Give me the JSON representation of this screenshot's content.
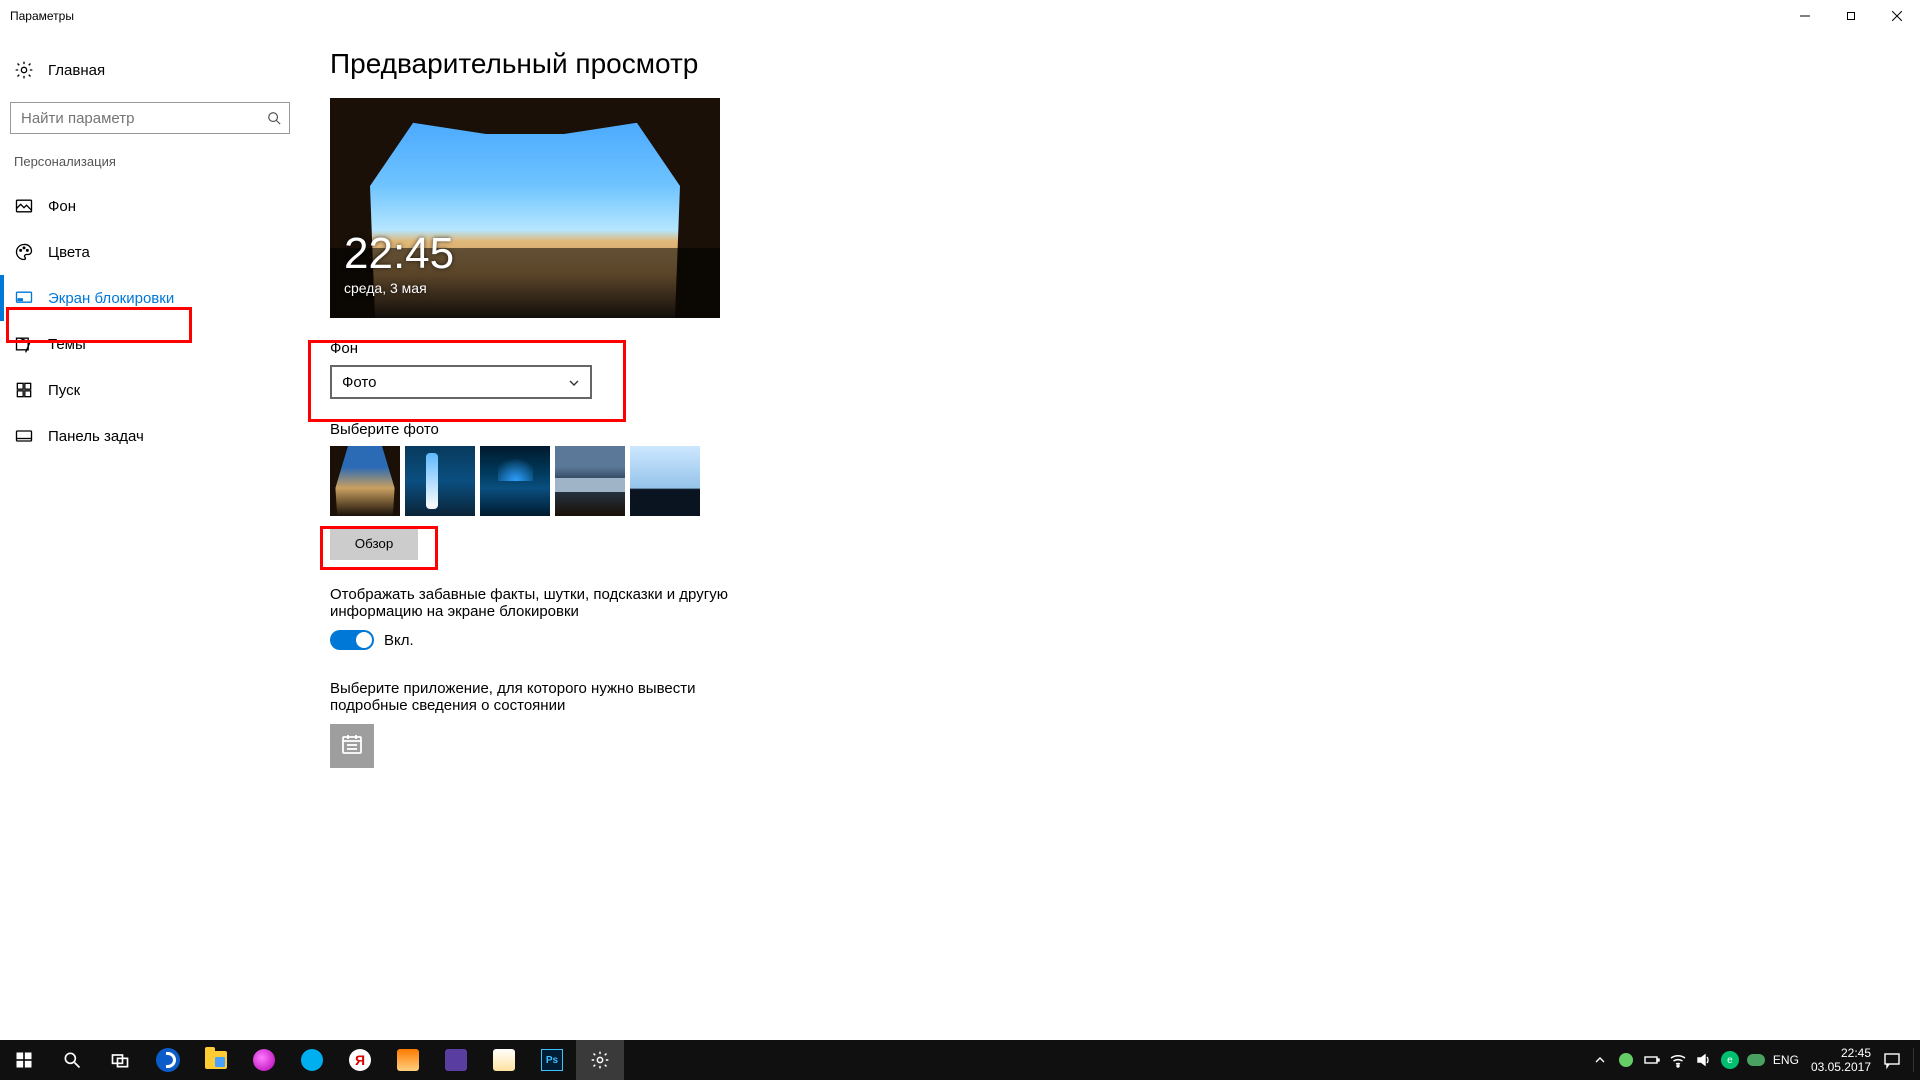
{
  "window": {
    "title": "Параметры"
  },
  "sidebar": {
    "home_label": "Главная",
    "search_placeholder": "Найти параметр",
    "section_label": "Персонализация",
    "items": [
      {
        "label": "Фон"
      },
      {
        "label": "Цвета"
      },
      {
        "label": "Экран блокировки"
      },
      {
        "label": "Темы"
      },
      {
        "label": "Пуск"
      },
      {
        "label": "Панель задач"
      }
    ]
  },
  "main": {
    "title": "Предварительный просмотр",
    "preview": {
      "time": "22:45",
      "date": "среда, 3 мая"
    },
    "background_label": "Фон",
    "background_dropdown_value": "Фото",
    "choose_photo_label": "Выберите фото",
    "browse_button": "Обзор",
    "fun_facts_text": "Отображать забавные факты, шутки, подсказки и другую информацию на экране блокировки",
    "toggle_label": "Вкл.",
    "detailed_app_text": "Выберите приложение, для которого нужно вывести подробные сведения о состоянии"
  },
  "taskbar": {
    "lang": "ENG",
    "clock_time": "22:45",
    "clock_date": "03.05.2017",
    "y_letter": "Я",
    "ps_label": "Ps"
  }
}
